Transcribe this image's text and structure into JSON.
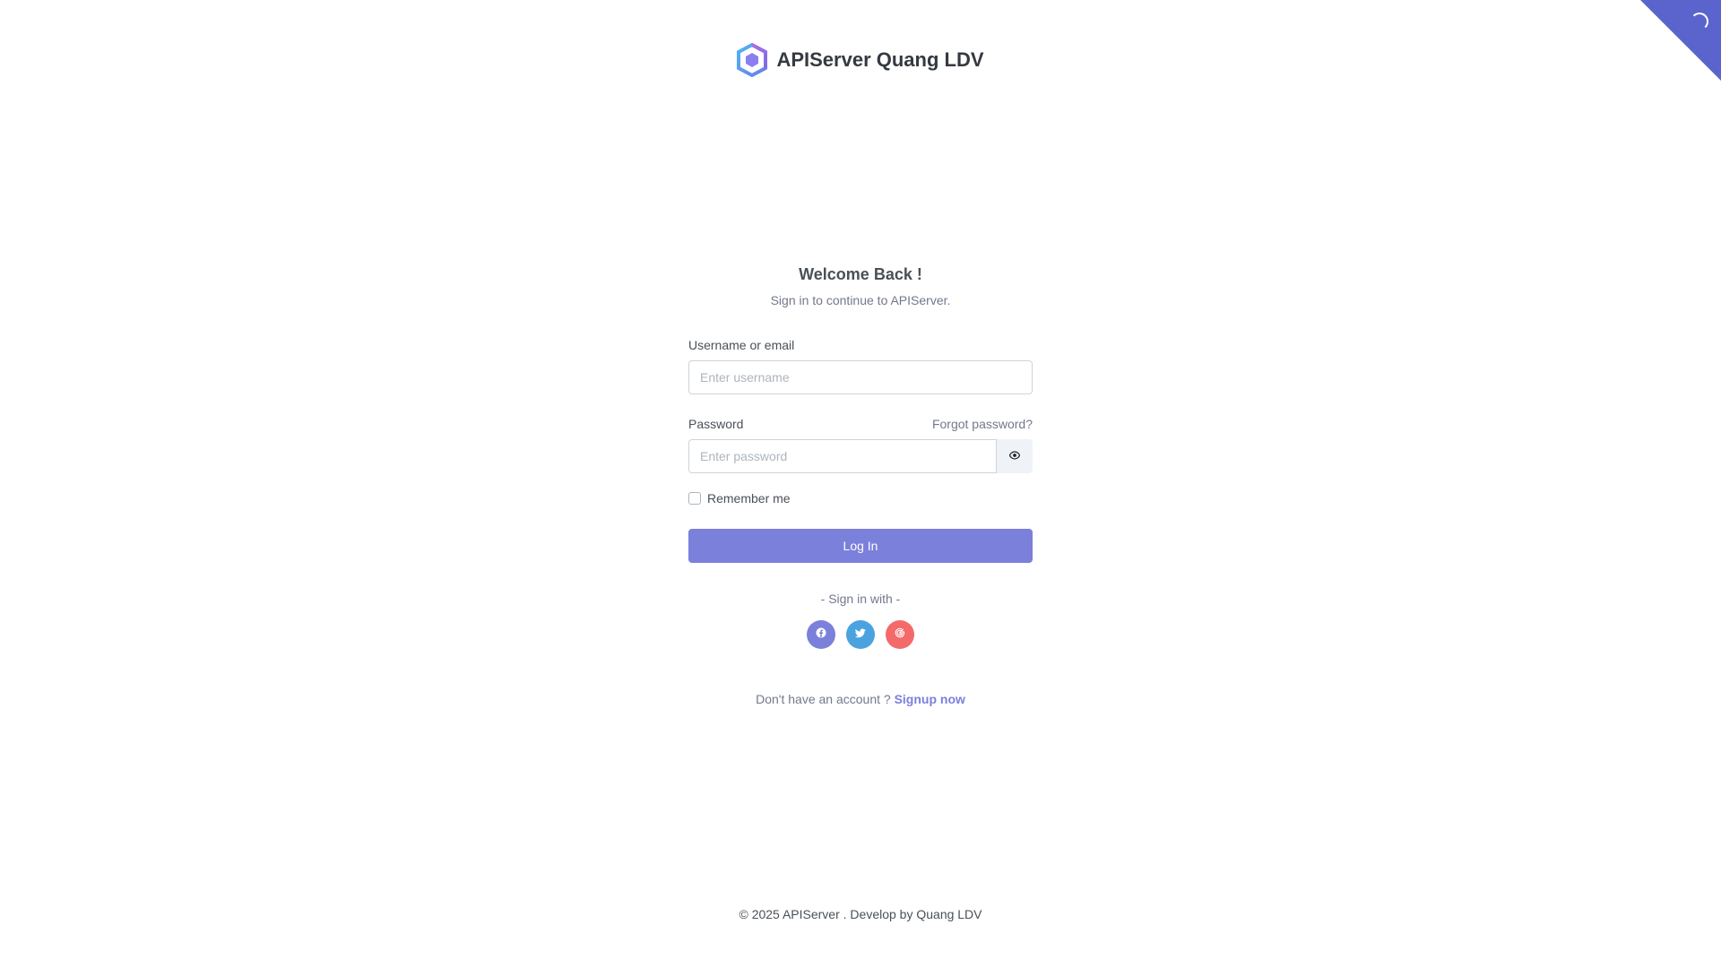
{
  "brand": {
    "name": "APIServer Quang LDV"
  },
  "login": {
    "title": "Welcome Back !",
    "subtitle": "Sign in to continue to APIServer.",
    "username_label": "Username or email",
    "username_placeholder": "Enter username",
    "username_value": "",
    "password_label": "Password",
    "forgot_link": "Forgot password?",
    "password_placeholder": "Enter password",
    "password_value": "",
    "remember_label": "Remember me",
    "remember_checked": false,
    "submit_label": "Log In",
    "sign_in_with": "- Sign in with -",
    "social": [
      {
        "icon": "facebook-icon",
        "color": "#7b80db"
      },
      {
        "icon": "twitter-icon",
        "color": "#4aa3df"
      },
      {
        "icon": "google-icon",
        "color": "#f46a6a"
      }
    ],
    "no_account_text": "Don't have an account ?",
    "signup_link": "Signup now"
  },
  "footer": {
    "text": "© 2025 APIServer . Develop by Quang LDV"
  },
  "colors": {
    "primary": "#7b80db",
    "ribbon": "#5b64cc",
    "text": "#495057",
    "muted": "#74788d"
  },
  "icons": {
    "logo": "hexagon-logo-icon",
    "password_toggle": "eye-icon",
    "loader": "spinner-icon"
  }
}
